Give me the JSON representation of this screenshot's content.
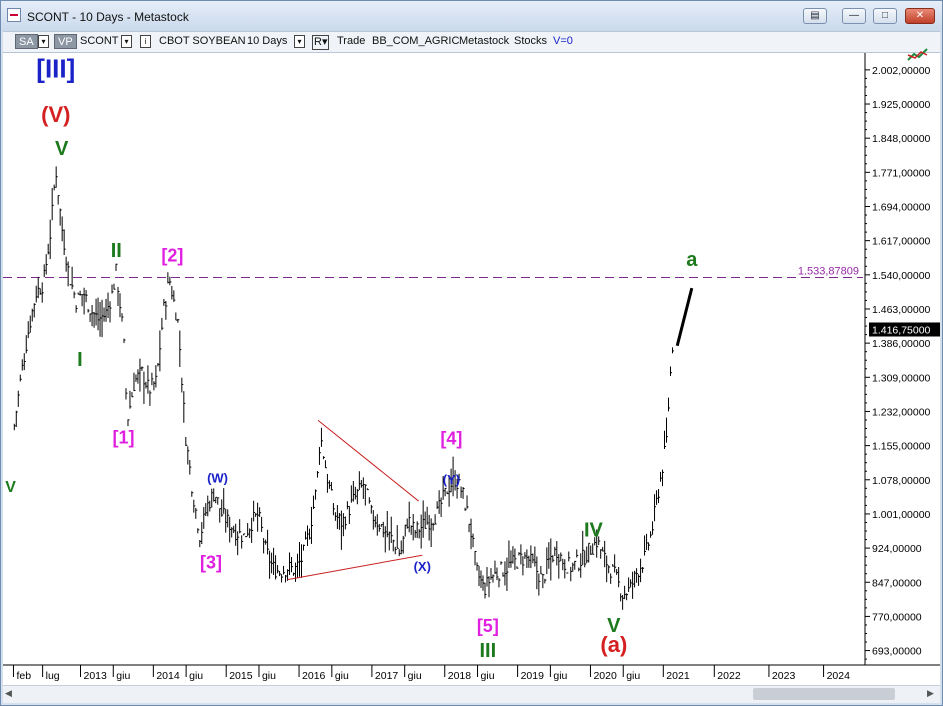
{
  "window": {
    "title": "SCONT - 10 Days - Metastock"
  },
  "toolbar": {
    "sa": "SA",
    "vp": "VP",
    "symbol": "SCONT",
    "description": "CBOT SOYBEAN",
    "period": "10 Days",
    "r_button": "R",
    "mode": "Trade",
    "source": "BB_COM_AGRIC",
    "provider": "Metastock",
    "market": "Stocks",
    "v_label": "V=0"
  },
  "chart_data": {
    "type": "ohlc",
    "x_tick_labels": [
      "feb",
      "lug",
      "2013",
      "giu",
      "2014",
      "giu",
      "2015",
      "giu",
      "2016",
      "giu",
      "2017",
      "giu",
      "2018",
      "giu",
      "2019",
      "giu",
      "2020",
      "giu",
      "2021",
      "2022",
      "2023",
      "2024"
    ],
    "y_tick_labels": [
      "2.002,00000",
      "1.925,00000",
      "1.848,00000",
      "1.771,00000",
      "1.694,00000",
      "1.617,00000",
      "1.540,00000",
      "1.463,00000",
      "1.386,00000",
      "1.309,00000",
      "1.232,00000",
      "1.155,00000",
      "1.078,00000",
      "1.001,00000",
      "924,00000",
      "847,00000",
      "770,00000",
      "693,00000"
    ],
    "y_ticks": [
      2002,
      1925,
      1848,
      1771,
      1694,
      1617,
      1540,
      1463,
      1386,
      1309,
      1232,
      1155,
      1078,
      1001,
      924,
      847,
      770,
      693
    ],
    "ylim": [
      665,
      2040
    ],
    "horizontal_line": {
      "value": 1533.87809,
      "label": "1.533,87809"
    },
    "last_price": {
      "value": 1416.75,
      "label": "1.416,75000"
    },
    "price_path": [
      [
        2012.05,
        1200
      ],
      [
        2012.15,
        1320
      ],
      [
        2012.25,
        1420
      ],
      [
        2012.35,
        1500
      ],
      [
        2012.45,
        1520
      ],
      [
        2012.55,
        1640
      ],
      [
        2012.62,
        1780
      ],
      [
        2012.7,
        1650
      ],
      [
        2012.8,
        1540
      ],
      [
        2012.9,
        1480
      ],
      [
        2013.0,
        1500
      ],
      [
        2013.1,
        1460
      ],
      [
        2013.2,
        1440
      ],
      [
        2013.3,
        1450
      ],
      [
        2013.4,
        1500
      ],
      [
        2013.45,
        1550
      ],
      [
        2013.55,
        1400
      ],
      [
        2013.6,
        1210
      ],
      [
        2013.7,
        1300
      ],
      [
        2013.8,
        1320
      ],
      [
        2013.9,
        1280
      ],
      [
        2014.0,
        1300
      ],
      [
        2014.1,
        1460
      ],
      [
        2014.18,
        1530
      ],
      [
        2014.3,
        1430
      ],
      [
        2014.4,
        1180
      ],
      [
        2014.5,
        1050
      ],
      [
        2014.6,
        950
      ],
      [
        2014.7,
        1020
      ],
      [
        2014.8,
        1050
      ],
      [
        2014.9,
        1000
      ],
      [
        2015.0,
        980
      ],
      [
        2015.1,
        960
      ],
      [
        2015.2,
        950
      ],
      [
        2015.3,
        980
      ],
      [
        2015.4,
        1000
      ],
      [
        2015.5,
        920
      ],
      [
        2015.6,
        880
      ],
      [
        2015.7,
        870
      ],
      [
        2015.8,
        880
      ],
      [
        2015.9,
        875
      ],
      [
        2016.0,
        900
      ],
      [
        2016.1,
        960
      ],
      [
        2016.2,
        1060
      ],
      [
        2016.25,
        1180
      ],
      [
        2016.35,
        1080
      ],
      [
        2016.45,
        1000
      ],
      [
        2016.55,
        980
      ],
      [
        2016.7,
        1030
      ],
      [
        2016.85,
        1070
      ],
      [
        2016.95,
        1000
      ],
      [
        2017.1,
        970
      ],
      [
        2017.25,
        940
      ],
      [
        2017.35,
        910
      ],
      [
        2017.45,
        990
      ],
      [
        2017.55,
        960
      ],
      [
        2017.7,
        980
      ],
      [
        2017.85,
        1000
      ],
      [
        2018.0,
        1060
      ],
      [
        2018.1,
        1080
      ],
      [
        2018.2,
        1050
      ],
      [
        2018.3,
        980
      ],
      [
        2018.4,
        870
      ],
      [
        2018.5,
        830
      ],
      [
        2018.6,
        860
      ],
      [
        2018.8,
        880
      ],
      [
        2019.0,
        900
      ],
      [
        2019.1,
        900
      ],
      [
        2019.2,
        880
      ],
      [
        2019.3,
        850
      ],
      [
        2019.4,
        900
      ],
      [
        2019.5,
        920
      ],
      [
        2019.6,
        890
      ],
      [
        2019.7,
        880
      ],
      [
        2019.85,
        900
      ],
      [
        2019.95,
        920
      ],
      [
        2020.05,
        940
      ],
      [
        2020.15,
        900
      ],
      [
        2020.3,
        860
      ],
      [
        2020.4,
        820
      ],
      [
        2020.5,
        830
      ],
      [
        2020.6,
        870
      ],
      [
        2020.7,
        900
      ],
      [
        2020.8,
        960
      ],
      [
        2020.9,
        1060
      ],
      [
        2021.0,
        1160
      ],
      [
        2021.05,
        1300
      ],
      [
        2021.1,
        1416.75
      ]
    ],
    "wave_labels": [
      {
        "text": "[III]",
        "x": 2012.62,
        "y": 1985,
        "color": "#1a22c8",
        "size": 26
      },
      {
        "text": "(V)",
        "x": 2012.62,
        "y": 1885,
        "color": "#d42020",
        "size": 22
      },
      {
        "text": "V",
        "x": 2012.7,
        "y": 1810,
        "color": "#1c7a1c",
        "size": 20
      },
      {
        "text": "II",
        "x": 2013.45,
        "y": 1580,
        "color": "#1c7a1c",
        "size": 20
      },
      {
        "text": "I",
        "x": 2012.95,
        "y": 1335,
        "color": "#1c7a1c",
        "size": 20
      },
      {
        "text": "[2]",
        "x": 2014.22,
        "y": 1570,
        "color": "#e020e0",
        "size": 18
      },
      {
        "text": "[1]",
        "x": 2013.55,
        "y": 1160,
        "color": "#e020e0",
        "size": 18
      },
      {
        "text": "(W)",
        "x": 2014.84,
        "y": 1072,
        "color": "#1a22c8",
        "size": 13
      },
      {
        "text": "[3]",
        "x": 2014.75,
        "y": 878,
        "color": "#e020e0",
        "size": 18
      },
      {
        "text": "[4]",
        "x": 2018.05,
        "y": 1158,
        "color": "#e020e0",
        "size": 18
      },
      {
        "text": "(Y)",
        "x": 2018.05,
        "y": 1068,
        "color": "#1a22c8",
        "size": 13
      },
      {
        "text": "(X)",
        "x": 2017.65,
        "y": 872,
        "color": "#1a22c8",
        "size": 13
      },
      {
        "text": "[5]",
        "x": 2018.55,
        "y": 735,
        "color": "#e020e0",
        "size": 18
      },
      {
        "text": "III",
        "x": 2018.55,
        "y": 678,
        "color": "#1c7a1c",
        "size": 20
      },
      {
        "text": "IV",
        "x": 2020.0,
        "y": 950,
        "color": "#1c7a1c",
        "size": 20
      },
      {
        "text": "V",
        "x": 2020.28,
        "y": 735,
        "color": "#1c7a1c",
        "size": 20
      },
      {
        "text": "(a)",
        "x": 2020.28,
        "y": 690,
        "color": "#d42020",
        "size": 22
      },
      {
        "text": "a",
        "x": 2021.35,
        "y": 1560,
        "color": "#1c7a1c",
        "size": 20
      },
      {
        "text": "V",
        "x": 2012.0,
        "y": 1050,
        "color": "#1c7a1c",
        "size": 16
      }
    ],
    "triangle_lines": [
      {
        "x1": 2016.22,
        "y1": 1212,
        "x2": 2017.6,
        "y2": 1030,
        "color": "#c82020"
      },
      {
        "x1": 2015.8,
        "y1": 853,
        "x2": 2017.65,
        "y2": 908,
        "color": "#c82020"
      }
    ],
    "projection_line": {
      "x1": 2021.15,
      "y1": 1380,
      "x2": 2021.35,
      "y2": 1510,
      "color": "#000000"
    }
  }
}
